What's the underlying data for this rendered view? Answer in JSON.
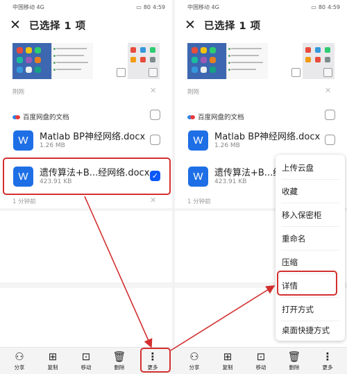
{
  "status": {
    "carrier": "中国移动",
    "network": "4G",
    "time": "4:59",
    "battery": "80"
  },
  "header": {
    "title": "已选择 1 项"
  },
  "recent_section": {
    "time_label": "刚刚"
  },
  "group": {
    "title": "百度网盘的文档"
  },
  "files": [
    {
      "name": "Matlab BP神经网络.docx",
      "size": "1.26 MB",
      "icon": "W",
      "checked": false
    },
    {
      "name": "遗传算法+B...经网络.docx",
      "size": "423.91 KB",
      "icon": "W",
      "checked": true
    }
  ],
  "older_section": {
    "time_label": "1 分钟前"
  },
  "bottom_tabs": [
    {
      "label": "分享",
      "icon": "share-icon"
    },
    {
      "label": "复制",
      "icon": "copy-icon"
    },
    {
      "label": "移动",
      "icon": "move-icon"
    },
    {
      "label": "删除",
      "icon": "trash-icon"
    },
    {
      "label": "更多",
      "icon": "more-vertical-icon"
    }
  ],
  "more_menu": [
    "上传云盘",
    "收藏",
    "移入保密柜",
    "重命名",
    "压缩",
    "详情",
    "打开方式",
    "桌面快捷方式"
  ],
  "colors": {
    "accent": "#0a59f7",
    "highlight": "#d32f2f",
    "word_blue": "#1e6fe6"
  }
}
